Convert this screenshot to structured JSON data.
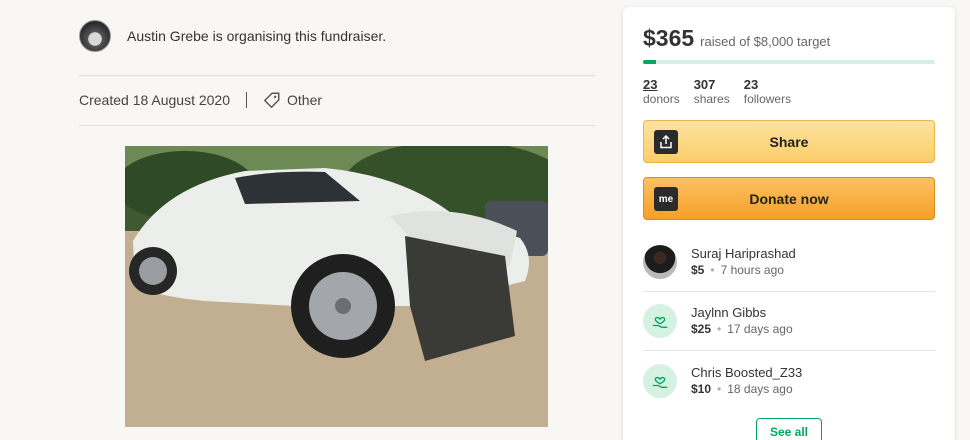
{
  "organiser": {
    "text": "Austin Grebe is organising this fundraiser."
  },
  "meta": {
    "created": "Created 18 August 2020",
    "category": "Other"
  },
  "campaign": {
    "raised": "$365",
    "target": "raised of $8,000 target",
    "progress_fraction": 0.046,
    "stats": [
      {
        "value": "23",
        "label": "donors"
      },
      {
        "value": "307",
        "label": "shares"
      },
      {
        "value": "23",
        "label": "followers"
      }
    ],
    "share_label": "Share",
    "donate_label": "Donate now",
    "donate_icon_text": "me",
    "see_all_label": "See all"
  },
  "donations": [
    {
      "name": "Suraj Hariprashad",
      "amount": "$5",
      "time": "7 hours ago",
      "avatar": "photo"
    },
    {
      "name": "Jaylnn Gibbs",
      "amount": "$25",
      "time": "17 days ago",
      "avatar": "heart-hand-icon"
    },
    {
      "name": "Chris Boosted_Z33",
      "amount": "$10",
      "time": "18 days ago",
      "avatar": "heart-hand-icon"
    }
  ],
  "colors": {
    "brand_green": "#02a95c",
    "share": "#fbcd6a",
    "donate": "#f5a028"
  }
}
